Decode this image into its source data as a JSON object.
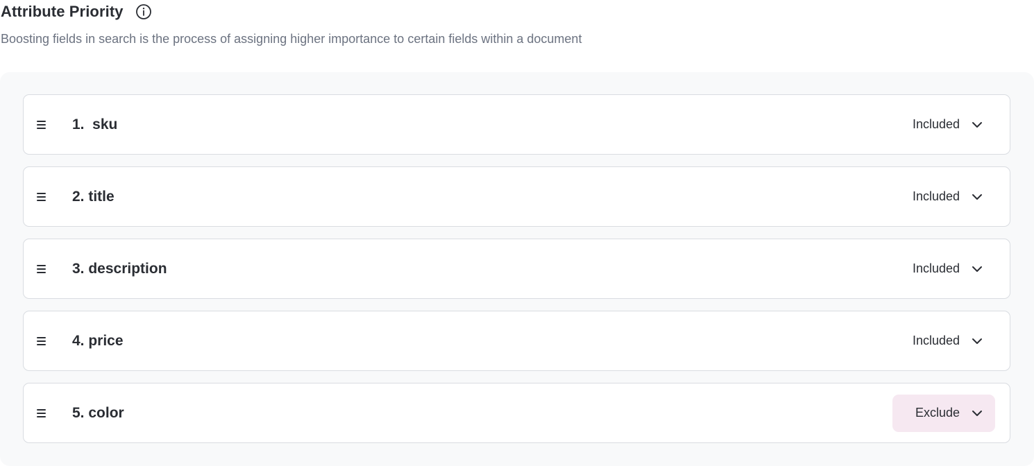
{
  "header": {
    "title": "Attribute Priority",
    "info_icon": "info-circle-icon",
    "subtitle": "Boosting fields in search is the process of assigning higher importance to certain fields within a document"
  },
  "attributes": [
    {
      "label": "1.  sku",
      "status": "Included",
      "excluded": false
    },
    {
      "label": "2. title",
      "status": "Included",
      "excluded": false
    },
    {
      "label": "3. description",
      "status": "Included",
      "excluded": false
    },
    {
      "label": "4. price",
      "status": "Included",
      "excluded": false
    },
    {
      "label": "5. color",
      "status": "Exclude",
      "excluded": true
    }
  ],
  "icons": {
    "drag": "drag-handle-icon",
    "chevron": "chevron-down-icon"
  },
  "colors": {
    "panel_bg": "#f8f9fa",
    "row_border": "#d9dce1",
    "exclude_bg": "#f6e8f1",
    "text": "#2a2d33",
    "muted": "#6b7280"
  }
}
